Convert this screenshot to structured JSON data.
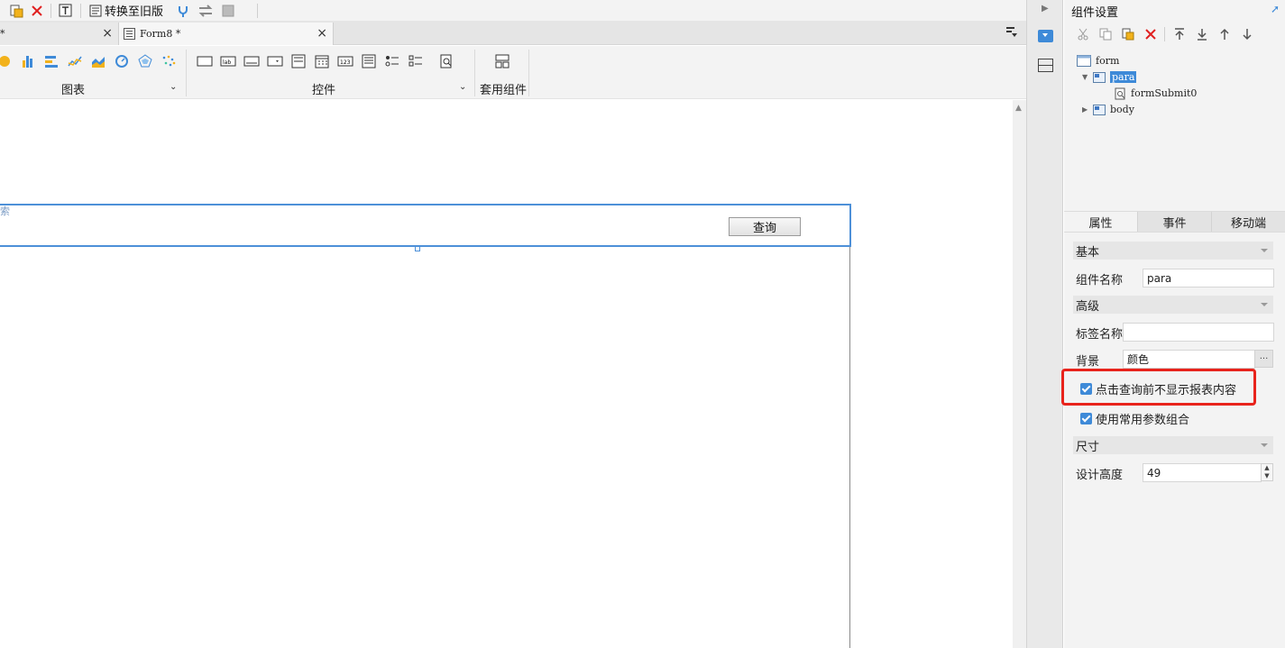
{
  "toolbar": {
    "convert_label": "转换至旧版"
  },
  "tabs": {
    "inactive_label": "*",
    "active_label": "Form8 *",
    "close_glyph": "×"
  },
  "ribbon": {
    "group_chart": "图表",
    "group_widget": "控件",
    "group_template": "套用组件"
  },
  "canvas": {
    "para_label": "索",
    "query_button": "查询"
  },
  "panel": {
    "title": "组件设置",
    "tree": {
      "form": "form",
      "para": "para",
      "formSubmit": "formSubmit0",
      "body": "body"
    },
    "tabs": [
      "属性",
      "事件",
      "移动端"
    ],
    "section_basic": "基本",
    "component_name_label": "组件名称",
    "component_name_value": "para",
    "section_advanced": "高级",
    "tag_name_label": "标签名称",
    "tag_name_value": "",
    "background_label": "背景",
    "background_value": "颜色",
    "ellipsis": "···",
    "checkbox_hide": "点击查询前不显示报表内容",
    "checkbox_params": "使用常用参数组合",
    "section_size": "尺寸",
    "design_height_label": "设计高度",
    "design_height_value": "49"
  },
  "colors": {
    "accent": "#3e8ad8",
    "highlight": "#e8231c",
    "selection_border": "#4d90d8"
  }
}
